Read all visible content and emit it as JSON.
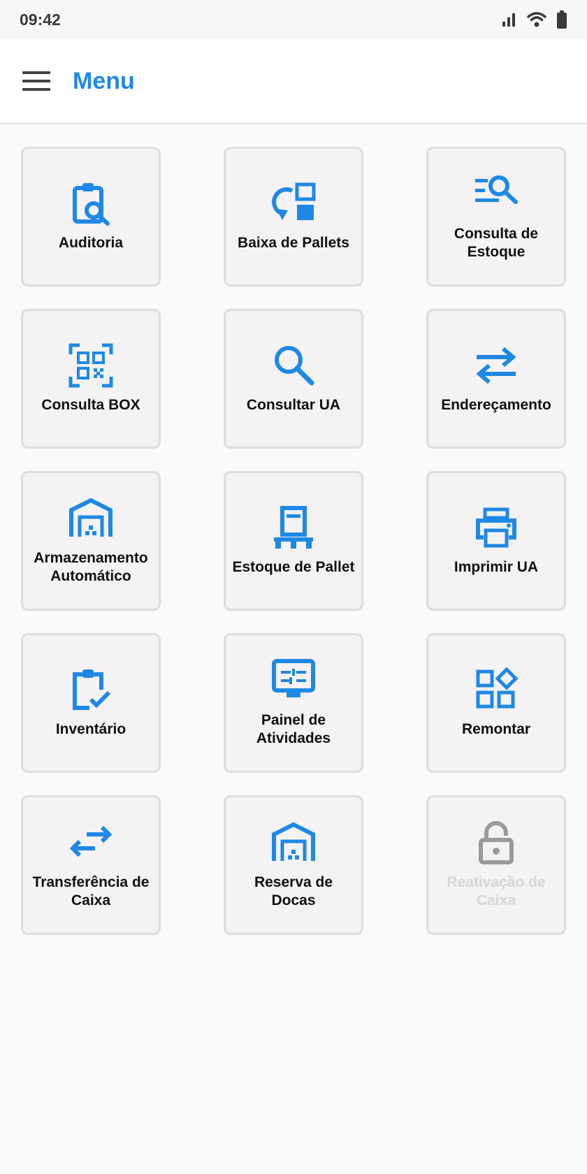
{
  "status_bar": {
    "time": "09:42"
  },
  "app_bar": {
    "title": "Menu"
  },
  "colors": {
    "accent": "#1e88e5",
    "disabled_icon": "#9a9a9a",
    "disabled_text": "#d6d6d6"
  },
  "menu": [
    {
      "label": "Auditoria",
      "icon": "clipboard-search-icon",
      "enabled": true
    },
    {
      "label": "Baixa de Pallets",
      "icon": "pallet-return-icon",
      "enabled": true
    },
    {
      "label": "Consulta de Estoque",
      "icon": "list-search-icon",
      "enabled": true
    },
    {
      "label": "Consulta BOX",
      "icon": "qr-scan-icon",
      "enabled": true
    },
    {
      "label": "Consultar UA",
      "icon": "search-icon",
      "enabled": true
    },
    {
      "label": "Endereçamento",
      "icon": "swap-horizontal-icon",
      "enabled": true
    },
    {
      "label": "Armazenamento Automático",
      "icon": "warehouse-icon",
      "enabled": true
    },
    {
      "label": "Estoque de Pallet",
      "icon": "pallet-box-icon",
      "enabled": true
    },
    {
      "label": "Imprimir UA",
      "icon": "printer-icon",
      "enabled": true
    },
    {
      "label": "Inventário",
      "icon": "clipboard-check-icon",
      "enabled": true
    },
    {
      "label": "Painel de Atividades",
      "icon": "activity-monitor-icon",
      "enabled": true
    },
    {
      "label": "Remontar",
      "icon": "widgets-icon",
      "enabled": true
    },
    {
      "label": "Transferência de Caixa",
      "icon": "transfer-arrows-icon",
      "enabled": true
    },
    {
      "label": "Reserva de Docas",
      "icon": "dock-warehouse-icon",
      "enabled": true
    },
    {
      "label": "Reativação de Caixa",
      "icon": "lock-open-icon",
      "enabled": false
    }
  ]
}
